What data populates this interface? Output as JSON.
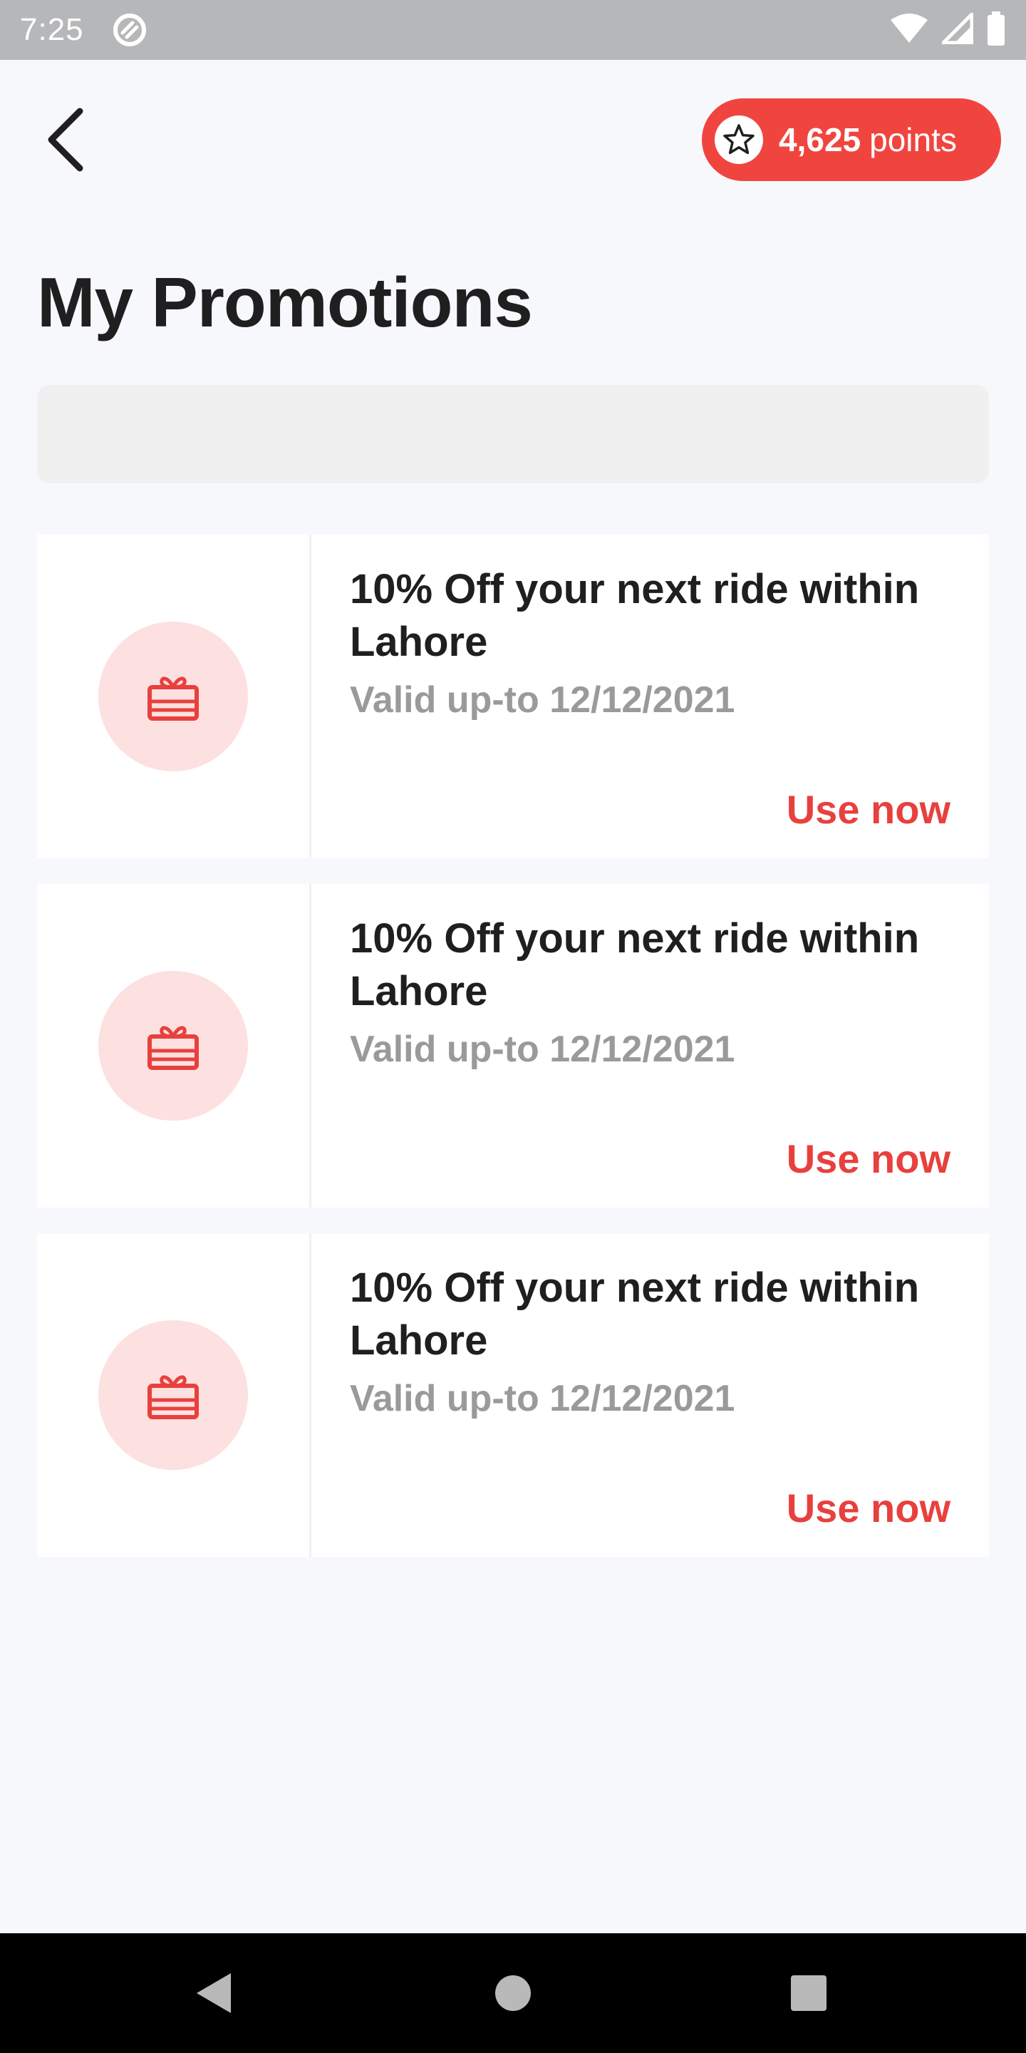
{
  "status_bar": {
    "time": "7:25",
    "icons": [
      "app-notification-icon",
      "wifi-icon",
      "signal-icon",
      "battery-icon"
    ]
  },
  "header": {
    "back_icon": "chevron-left-icon",
    "points": {
      "icon": "star-icon",
      "value": "4,625",
      "unit": "points",
      "color": "#f0453f"
    }
  },
  "page": {
    "title": "My Promotions"
  },
  "search": {
    "value": "",
    "placeholder": ""
  },
  "promotions": [
    {
      "icon": "gift-card-icon",
      "title": "10% Off your next ride within Lahore",
      "validity": "Valid up-to 12/12/2021",
      "cta": "Use now"
    },
    {
      "icon": "gift-card-icon",
      "title": "10% Off your next ride within Lahore",
      "validity": "Valid up-to 12/12/2021",
      "cta": "Use now"
    },
    {
      "icon": "gift-card-icon",
      "title": "10% Off your next ride within Lahore",
      "validity": "Valid up-to 12/12/2021",
      "cta": "Use now"
    }
  ],
  "nav_bar": {
    "icons": [
      "nav-back-icon",
      "nav-home-icon",
      "nav-recents-icon"
    ]
  },
  "colors": {
    "accent": "#e8403d",
    "icon_bg": "#fde0e0",
    "background": "#f7f8fc"
  }
}
